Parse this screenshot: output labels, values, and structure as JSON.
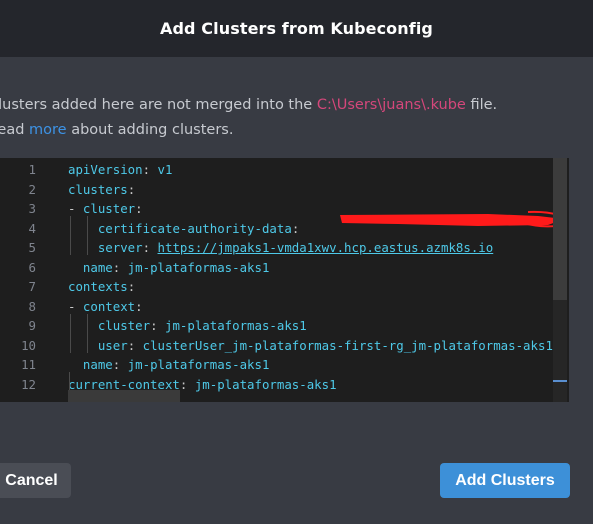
{
  "dialog": {
    "title": "Add Clusters from Kubeconfig"
  },
  "description": {
    "line1_prefix": "Clusters added here are not merged into the ",
    "line1_path": "C:\\Users\\juans\\.kube",
    "line1_suffix": " file.",
    "line2_prefix": "Read ",
    "line2_link": "more",
    "line2_suffix": " about adding clusters."
  },
  "editor": {
    "lines": [
      {
        "n": "1",
        "indent": "",
        "key": "apiVersion",
        "sep": ": ",
        "val": "v1",
        "type": "plain"
      },
      {
        "n": "2",
        "indent": "",
        "key": "clusters",
        "sep": ":",
        "val": "",
        "type": "plain"
      },
      {
        "n": "3",
        "indent": "- ",
        "key": "cluster",
        "sep": ":",
        "val": "",
        "type": "plain"
      },
      {
        "n": "4",
        "indent": "    ",
        "key": "certificate-authority-data",
        "sep": ":",
        "val": "",
        "type": "plain"
      },
      {
        "n": "5",
        "indent": "    ",
        "key": "server",
        "sep": ": ",
        "val": "https://jmpaks1-vmda1xwv.hcp.eastus.azmk8s.io",
        "type": "url"
      },
      {
        "n": "6",
        "indent": "  ",
        "key": "name",
        "sep": ": ",
        "val": "jm-plataformas-aks1",
        "type": "plain"
      },
      {
        "n": "7",
        "indent": "",
        "key": "contexts",
        "sep": ":",
        "val": "",
        "type": "plain"
      },
      {
        "n": "8",
        "indent": "- ",
        "key": "context",
        "sep": ":",
        "val": "",
        "type": "plain"
      },
      {
        "n": "9",
        "indent": "    ",
        "key": "cluster",
        "sep": ": ",
        "val": "jm-plataformas-aks1",
        "type": "plain"
      },
      {
        "n": "10",
        "indent": "    ",
        "key": "user",
        "sep": ": ",
        "val": "clusterUser_jm-plataformas-first-rg_jm-plataformas-aks1",
        "type": "plain"
      },
      {
        "n": "11",
        "indent": "  ",
        "key": "name",
        "sep": ": ",
        "val": "jm-plataformas-aks1",
        "type": "plain"
      },
      {
        "n": "12",
        "indent": "",
        "key": "current-context",
        "sep": ": ",
        "val": "jm-plataformas-aks1",
        "type": "plain"
      }
    ]
  },
  "buttons": {
    "cancel": "Cancel",
    "add": "Add Clusters"
  },
  "colors": {
    "path": "#d5477b",
    "link": "#3d93e6",
    "primary": "#3d90d8",
    "yaml_key": "#4ec9e8",
    "redaction": "#ff1a1a"
  }
}
